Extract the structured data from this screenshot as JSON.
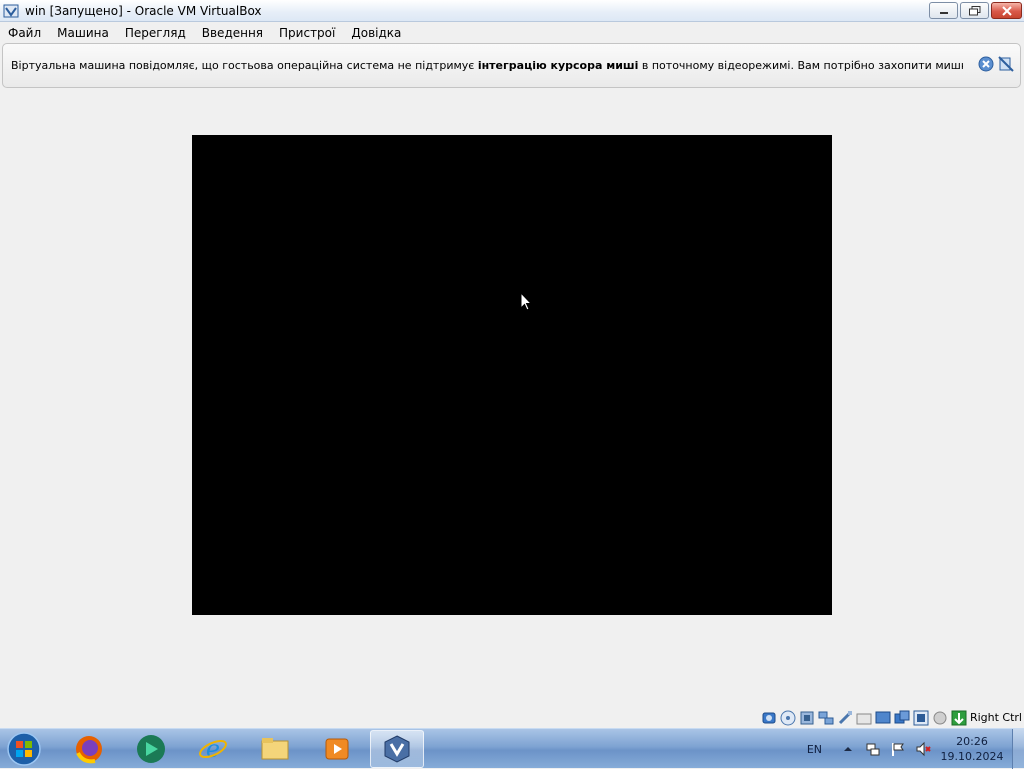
{
  "window": {
    "title": "win [Запущено] - Oracle VM VirtualBox"
  },
  "menu": {
    "items": [
      "Файл",
      "Машина",
      "Перегляд",
      "Введення",
      "Пристрої",
      "Довідка"
    ]
  },
  "notice": {
    "text_before": "Віртуальна машина повідомляє, що гостьова операційна система не підтримує ",
    "text_bold": "інтеграцію курсора миші",
    "text_after": " в поточному відеорежимі. Вам потрібно захопити мишку (клацнувши на екран"
  },
  "statusbar": {
    "host_key": "Right Ctrl",
    "icons": [
      "hard-disk-icon",
      "optical-disk-icon",
      "audio-icon",
      "network-icon",
      "usb-icon",
      "shared-folders-icon",
      "display-icon",
      "capture-icon",
      "video-capture-icon",
      "cpu-icon",
      "mouse-integration-icon",
      "keyboard-capture-icon"
    ]
  },
  "taskbar": {
    "apps": [
      "firefox-icon",
      "browser-icon",
      "internet-explorer-icon",
      "file-explorer-icon",
      "media-player-icon",
      "virtualbox-icon"
    ],
    "active_app": "virtualbox-icon",
    "language": "EN",
    "time": "20:26",
    "date": "19.10.2024"
  }
}
